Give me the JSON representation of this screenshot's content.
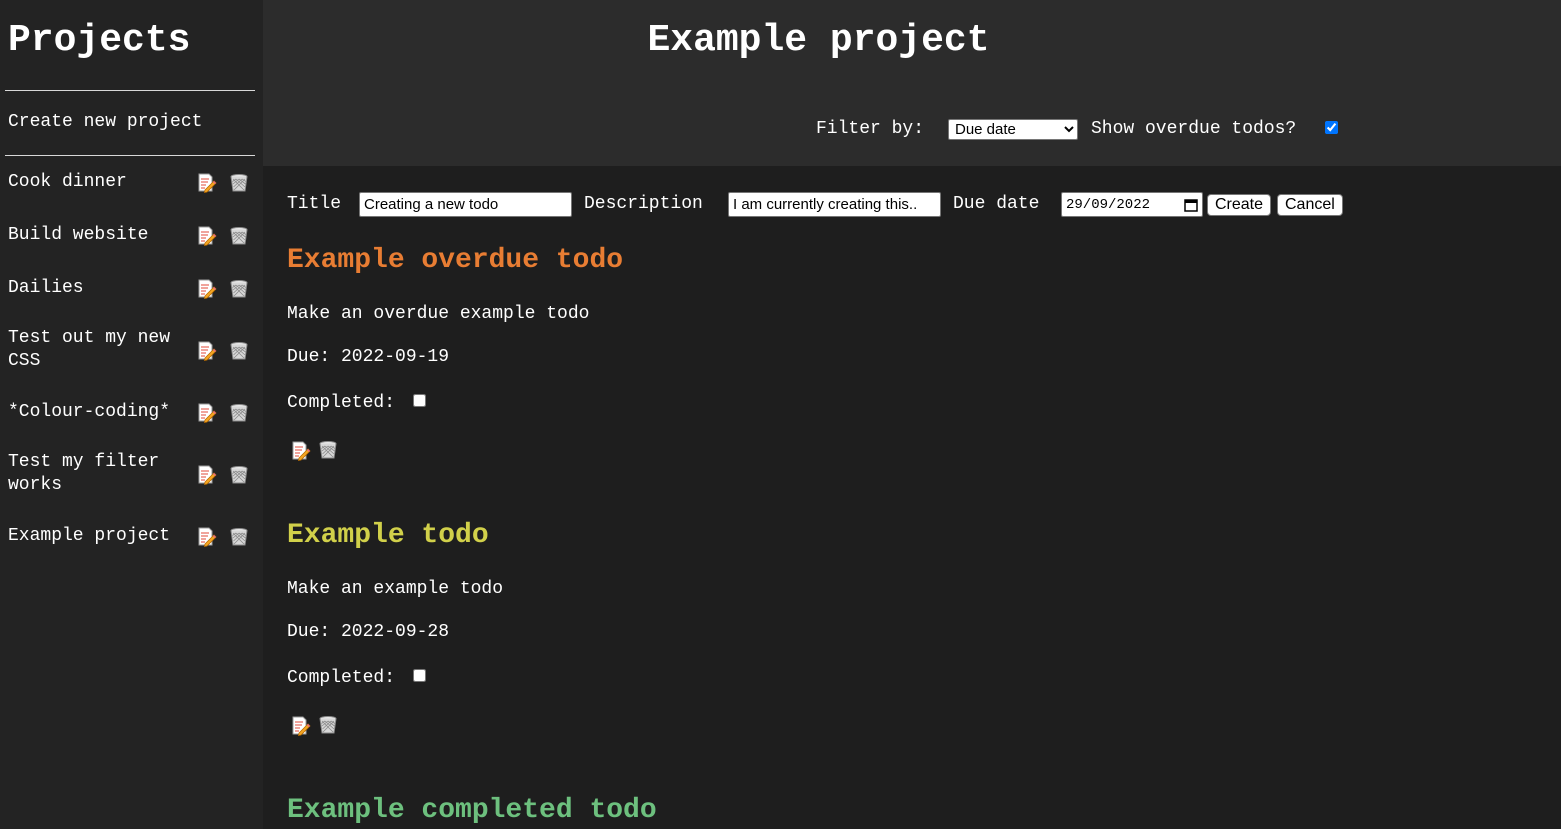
{
  "sidebar": {
    "title": "Projects",
    "create_label": "Create new project",
    "projects": [
      {
        "label": "Cook dinner"
      },
      {
        "label": "Build website"
      },
      {
        "label": "Dailies"
      },
      {
        "label": "Test out my new CSS"
      },
      {
        "label": "*Colour-coding*"
      },
      {
        "label": "Test my filter works"
      },
      {
        "label": "Example project"
      }
    ]
  },
  "header": {
    "title": "Example project",
    "filter_label": "Filter by:",
    "filter_value": "Due date",
    "overdue_label": "Show overdue todos?",
    "overdue_checked": true
  },
  "form": {
    "title_label": "Title",
    "title_value": "Creating a new todo",
    "description_label": "Description",
    "description_value": "I am currently creating this..",
    "due_label": "Due date",
    "due_value": "29/09/2022",
    "create_label": "Create",
    "cancel_label": "Cancel"
  },
  "todos": [
    {
      "title": "Example overdue todo",
      "color": "#e87d33",
      "description": "Make an overdue example todo",
      "due": "Due: 2022-09-19",
      "completed_label": "Completed:",
      "completed": false
    },
    {
      "title": "Example todo",
      "color": "#d1d04a",
      "description": "Make an example todo",
      "due": "Due: 2022-09-28",
      "completed_label": "Completed:",
      "completed": false
    },
    {
      "title": "Example completed todo",
      "color": "#6dc07e"
    }
  ],
  "icons": {
    "edit": "edit-memo-icon",
    "delete": "wastebasket-icon"
  }
}
